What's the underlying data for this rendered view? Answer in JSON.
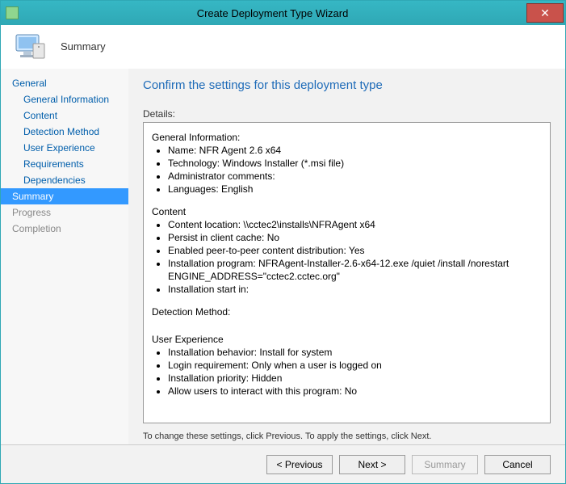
{
  "window": {
    "title": "Create Deployment Type Wizard"
  },
  "header": {
    "step_title": "Summary"
  },
  "sidebar": {
    "items": [
      {
        "label": "General",
        "child": false,
        "state": "normal"
      },
      {
        "label": "General Information",
        "child": true,
        "state": "normal"
      },
      {
        "label": "Content",
        "child": true,
        "state": "normal"
      },
      {
        "label": "Detection Method",
        "child": true,
        "state": "normal"
      },
      {
        "label": "User Experience",
        "child": true,
        "state": "normal"
      },
      {
        "label": "Requirements",
        "child": true,
        "state": "normal"
      },
      {
        "label": "Dependencies",
        "child": true,
        "state": "normal"
      },
      {
        "label": "Summary",
        "child": false,
        "state": "selected"
      },
      {
        "label": "Progress",
        "child": false,
        "state": "disabled"
      },
      {
        "label": "Completion",
        "child": false,
        "state": "disabled"
      }
    ]
  },
  "main": {
    "heading": "Confirm the settings for this deployment type",
    "details_label": "Details:",
    "hint": "To change these settings, click Previous. To apply the settings, click Next."
  },
  "details": {
    "general_info_title": "General Information:",
    "gi_name": "Name: NFR Agent 2.6 x64",
    "gi_tech": "Technology: Windows Installer (*.msi file)",
    "gi_admin": "Administrator comments:",
    "gi_lang": "Languages: English",
    "content_title": "Content",
    "c_location": "Content location: \\\\cctec2\\installs\\NFRAgent x64",
    "c_persist": "Persist in client cache: No",
    "c_p2p": "Enabled peer-to-peer content distribution: Yes",
    "c_install_prog_l1": "Installation program: NFRAgent-Installer-2.6-x64-12.exe /quiet /install /norestart",
    "c_install_prog_l2": "ENGINE_ADDRESS=\"cctec2.cctec.org\"",
    "c_install_start": "Installation start in:",
    "detect_title": "Detection Method:",
    "ux_title": "User Experience",
    "ux_behavior": "Installation behavior: Install for system",
    "ux_login": "Login requirement: Only when a user is logged on",
    "ux_priority": "Installation priority: Hidden",
    "ux_interact": "Allow users to interact with this program: No"
  },
  "buttons": {
    "previous": "< Previous",
    "next": "Next >",
    "summary": "Summary",
    "cancel": "Cancel"
  }
}
